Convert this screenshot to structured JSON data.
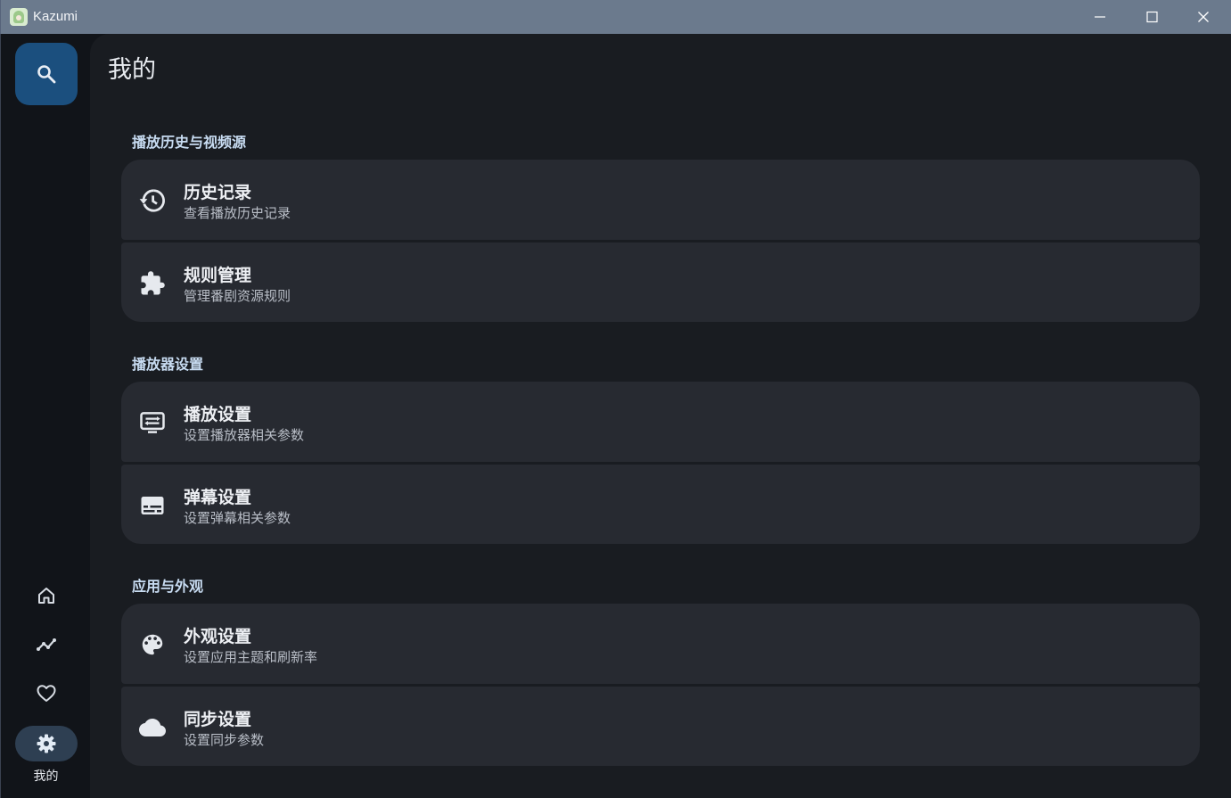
{
  "window": {
    "title": "Kazumi"
  },
  "rail": {
    "active_label": "我的"
  },
  "page": {
    "title": "我的"
  },
  "sections": [
    {
      "title": "播放历史与视频源",
      "items": [
        {
          "title": "历史记录",
          "subtitle": "查看播放历史记录",
          "icon": "history-icon"
        },
        {
          "title": "规则管理",
          "subtitle": "管理番剧资源规则",
          "icon": "extension-icon"
        }
      ]
    },
    {
      "title": "播放器设置",
      "items": [
        {
          "title": "播放设置",
          "subtitle": "设置播放器相关参数",
          "icon": "settings-display-icon"
        },
        {
          "title": "弹幕设置",
          "subtitle": "设置弹幕相关参数",
          "icon": "subtitles-icon"
        }
      ]
    },
    {
      "title": "应用与外观",
      "items": [
        {
          "title": "外观设置",
          "subtitle": "设置应用主题和刷新率",
          "icon": "palette-icon"
        },
        {
          "title": "同步设置",
          "subtitle": "设置同步参数",
          "icon": "cloud-icon"
        }
      ]
    }
  ],
  "colors": {
    "titlebar": "#6b7a8d",
    "background": "#111419",
    "panel": "#191c21",
    "card": "#272a31",
    "accent_fab": "#1b4f7e",
    "section_title": "#c8dcf2"
  }
}
